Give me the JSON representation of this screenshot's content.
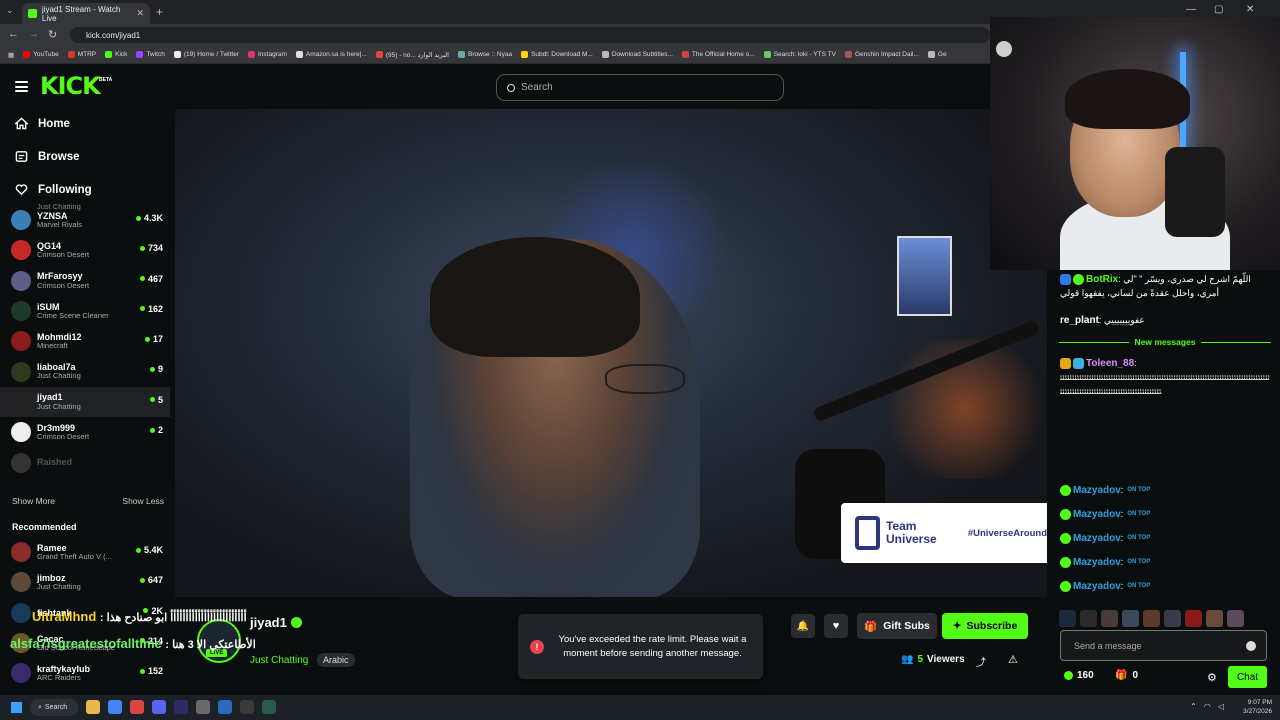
{
  "browser": {
    "tab_title": "jiyad1 Stream - Watch Live",
    "url": "kick.com/jiyad1",
    "bookmarks": [
      "YouTube",
      "MTRP",
      "Kick",
      "Twitch",
      "(19) Home / Twitter",
      "Instagram",
      "Amazon.sa is here|...",
      "(95) - no... البريد الوارد",
      "Browse :: Nyaa",
      "Subdl: Download M...",
      "Download Subtitles...",
      "The Official Home o...",
      "Search: loki - YTS TV",
      "Genshin Impact Dail...",
      "Ge"
    ]
  },
  "header": {
    "logo": "KICK",
    "beta": "BETA",
    "search_placeholder": "Search"
  },
  "sidebar": {
    "nav": [
      {
        "label": "Home",
        "icon": "home-icon"
      },
      {
        "label": "Browse",
        "icon": "browse-icon"
      },
      {
        "label": "Following",
        "icon": "heart-icon"
      }
    ],
    "partial_top": "Just Chatting",
    "following": [
      {
        "name": "YZNSA",
        "category": "Marvel Rivals",
        "viewers": "4.3K"
      },
      {
        "name": "QG14",
        "category": "Crimson Desert",
        "viewers": "734"
      },
      {
        "name": "MrFarosyy",
        "category": "Crimson Desert",
        "viewers": "467"
      },
      {
        "name": "iSUM",
        "category": "Crime Scene Cleaner",
        "viewers": "162"
      },
      {
        "name": "Mohmdi12",
        "category": "Minecraft",
        "viewers": "17"
      },
      {
        "name": "liaboal7a",
        "category": "Just Chatting",
        "viewers": "9"
      },
      {
        "name": "jiyad1",
        "category": "Just Chatting",
        "viewers": "5"
      },
      {
        "name": "Dr3m999",
        "category": "Crimson Desert",
        "viewers": "2"
      },
      {
        "name": "Raished",
        "category": "",
        "viewers": ""
      }
    ],
    "show_more": "Show More",
    "show_less": "Show Less",
    "recommended_title": "Recommended",
    "recommended": [
      {
        "name": "Ramee",
        "category": "Grand Theft Auto V (...",
        "viewers": "5.4K"
      },
      {
        "name": "jimboz",
        "category": "Just Chatting",
        "viewers": "647"
      },
      {
        "name": "fishtank",
        "category": "",
        "viewers": "2K"
      },
      {
        "name": "Cacac",
        "category": "Old School RuneScape",
        "viewers": "214"
      },
      {
        "name": "kraftykaylub",
        "category": "ARC Raiders",
        "viewers": "152"
      }
    ]
  },
  "video": {
    "banner_team": "Team Universe",
    "banner_tag": "#UniverseAround"
  },
  "overlay": {
    "line1_user": "UltraMhnd",
    "line1_text": ": ﺃﺃﺃﺃﺃﺃﺃﺃﺃﺃﺃﺃﺃﺃﺃﺃﺃﺃﺃﺃﺃﺃﺃﺃﺃ ابو صنادح هذا",
    "line2_user": "alsfa7isgreatestofalltime",
    "line2_text": ": الأطاعتكي الا 3 هنا"
  },
  "channel": {
    "name": "jiyad1",
    "live": "LIVE",
    "category": "Just Chatting",
    "tag": "Arabic",
    "viewers_count": "5",
    "viewers_label": "Viewers",
    "gift_subs": "Gift Subs",
    "subscribe": "Subscribe"
  },
  "toast": {
    "message": "You've exceeded the rate limit. Please wait a moment before sending another message."
  },
  "chat": {
    "messages": [
      {
        "user": "BotRix",
        "text": "اللّهمّ اشرح لي صدري، ويسّر \" \"لي أمري، واحلل عقدةً من لساني، يفقهوا قولي"
      },
      {
        "user": "re_plant",
        "text": "عفويييييييي"
      }
    ],
    "new_messages": "New messages",
    "toleen_user": "Toleen_88",
    "toleen_text": "ﺋﺌﺌﺌﺌﺌﺌﺌﺌﺌﺌﺌﺌﺌﺌﺌﺌﺌﺌﺌﺌﺌﺌﺌﺌﺌﺌﺌﺌﺌﺌﺌﺌﺌﺌﺌﺌﺌﺌﺌﺌﺌﺌﺌﺌﺌﺌﺌﺌﺌﺌﺌﺌﺌﺌﺌﺌﺌﺌﺌﺌﺌﺌﺌﺌﺌﺌﺌﺌﺌﺌﺌﺌﺌﺌﺌﺌﺌﺌﺌﺌﺌﺌﺌﺌﺌﺌﺌﺌﺌﺌﺌﺌﺌﺌﺌﺌﺌﺌﺌﺌﺌﺌﺌﺌﺌﺌﺌﺌﺌﺌﺌﺌﺌﺌﺌﺌﺌﺌﺌﺌﺌﺌﺌﺌﺌﺌﺌﺌ",
    "mazyadov": [
      "Mazyadov",
      "Mazyadov",
      "Mazyadov",
      "Mazyadov",
      "Mazyadov"
    ],
    "emote_text": "ON TOP",
    "input_placeholder": "Send a message",
    "points": "160",
    "gift_count": "0",
    "chat_button": "Chat"
  },
  "taskbar": {
    "search": "Search",
    "time": "9:07 PM",
    "date": "3/27/2026"
  },
  "colors": {
    "brand": "#53fc18",
    "bg": "#0b0e0f",
    "error": "#f0414f"
  }
}
